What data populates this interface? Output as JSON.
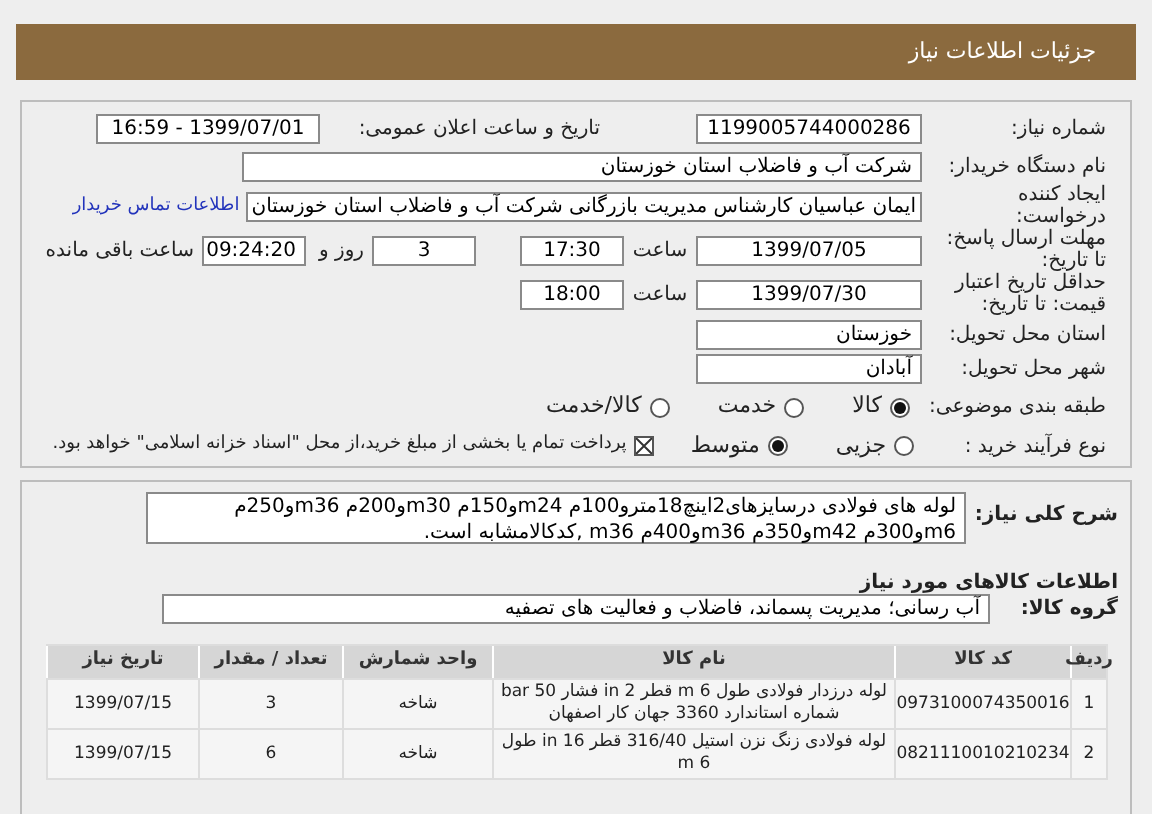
{
  "header": {
    "title": "جزئیات اطلاعات نیاز"
  },
  "form": {
    "need_number": {
      "label": "شماره نیاز:",
      "value": "1199005744000286"
    },
    "announce": {
      "label": "تاریخ و ساعت اعلان عمومی:",
      "value": "1399/07/01 - 16:59"
    },
    "buyer": {
      "label": "نام دستگاه خریدار:",
      "value": "شرکت آب و فاضلاب استان خوزستان"
    },
    "creator": {
      "label": "ایجاد کننده درخواست:",
      "value": "ایمان عباسیان کارشناس مدیریت بازرگانی شرکت آب و فاضلاب استان خوزستان",
      "link": "اطلاعات تماس خریدار"
    },
    "deadline": {
      "label": "مهلت ارسال پاسخ: تا تاریخ:",
      "date": "1399/07/05",
      "time_label": "ساعت",
      "time": "17:30",
      "days": "3",
      "days_label": "روز و",
      "remaining": "09:24:20",
      "remaining_label": "ساعت باقی مانده"
    },
    "validity": {
      "label": "حداقل تاریخ اعتبار قیمت: تا تاریخ:",
      "date": "1399/07/30",
      "time_label": "ساعت",
      "time": "18:00"
    },
    "province": {
      "label": "استان محل تحویل:",
      "value": "خوزستان"
    },
    "city": {
      "label": "شهر محل تحویل:",
      "value": "آبادان"
    },
    "category": {
      "label": "طبقه بندی موضوعی:",
      "options": [
        {
          "label": "کالا",
          "selected": true
        },
        {
          "label": "خدمت",
          "selected": false
        },
        {
          "label": "کالا/خدمت",
          "selected": false
        }
      ]
    },
    "process": {
      "label": "نوع فرآیند خرید :",
      "options": [
        {
          "label": "جزیی",
          "selected": false
        },
        {
          "label": "متوسط",
          "selected": true
        }
      ],
      "payment": {
        "checked": true,
        "text": "پرداخت تمام یا بخشی از مبلغ خرید،از محل \"اسناد خزانه اسلامی\" خواهد بود."
      }
    }
  },
  "details": {
    "description": {
      "label": "شرح کلی نیاز:",
      "value": "لوله های فولادی درسایزهای2اینچ18مترو100م m24و150م m30و200م m36و250م m6و300م m42و350م m36و400م m36 ,کدکالامشابه است."
    },
    "goods_heading": "اطلاعات کالاهای مورد نیاز",
    "group": {
      "label": "گروه کالا:",
      "value": "آب رسانی؛ مدیریت پسماند، فاضلاب و فعالیت های تصفیه"
    },
    "table": {
      "columns": [
        "ردیف",
        "کد کالا",
        "نام کالا",
        "واحد شمارش",
        "تعداد / مقدار",
        "تاریخ نیاز"
      ],
      "rows": [
        [
          "1",
          "0973100074350016",
          "لوله درزدار فولادی طول 6 m قطر 2 in فشار 50 bar شماره استاندارد 3360 جهان کار اصفهان",
          "شاخه",
          "3",
          "1399/07/15"
        ],
        [
          "2",
          "0821110010210234",
          "لوله فولادی زنگ نزن استیل 316/40 قطر 16 in طول 6 m",
          "شاخه",
          "6",
          "1399/07/15"
        ]
      ]
    }
  }
}
